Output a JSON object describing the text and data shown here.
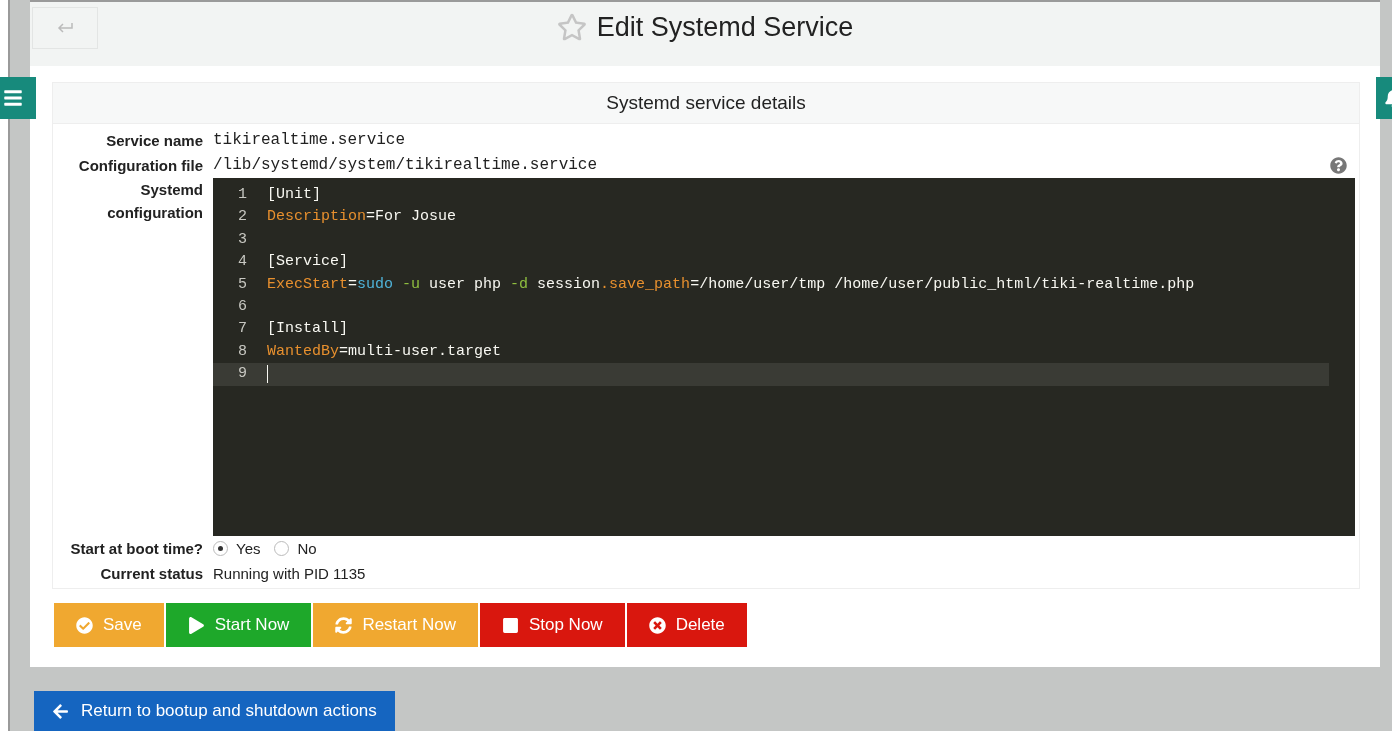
{
  "header": {
    "title": "Edit Systemd Service"
  },
  "panel": {
    "heading": "Systemd service details"
  },
  "fields": [
    {
      "label": "Service name",
      "value": "tikirealtime.service"
    },
    {
      "label": "Configuration file",
      "value": "/lib/systemd/system/tikirealtime.service"
    }
  ],
  "editor": {
    "label": "Systemd configuration",
    "lines": [
      {
        "number": "1",
        "active": false,
        "tokens": [
          {
            "kind": "plain",
            "text": "[Unit]"
          }
        ]
      },
      {
        "number": "2",
        "active": false,
        "tokens": [
          {
            "kind": "key",
            "text": "Description"
          },
          {
            "kind": "plain",
            "text": "=For Josue"
          }
        ]
      },
      {
        "number": "3",
        "active": false
      },
      {
        "number": "4",
        "active": false,
        "tokens": [
          {
            "kind": "plain",
            "text": "[Service]"
          }
        ]
      },
      {
        "number": "5",
        "active": false,
        "tokens": [
          {
            "kind": "key",
            "text": "ExecStart"
          },
          {
            "kind": "plain",
            "text": "="
          },
          {
            "kind": "command",
            "text": "sudo "
          },
          {
            "kind": "flag",
            "text": "-u"
          },
          {
            "kind": "plain",
            "text": " user php "
          },
          {
            "kind": "flag",
            "text": "-d"
          },
          {
            "kind": "plain",
            "text": " session"
          },
          {
            "kind": "key",
            "text": ".save_path"
          },
          {
            "kind": "plain",
            "text": "=/home/user/tmp /home/user/public_html/tiki-realtime.php"
          }
        ]
      },
      {
        "number": "6",
        "active": false
      },
      {
        "number": "7",
        "active": false,
        "tokens": [
          {
            "kind": "plain",
            "text": "[Install]"
          }
        ]
      },
      {
        "number": "8",
        "active": false,
        "tokens": [
          {
            "kind": "key",
            "text": "WantedBy"
          },
          {
            "kind": "plain",
            "text": "=multi-user.target"
          }
        ]
      },
      {
        "number": "9",
        "active": true
      }
    ]
  },
  "boot": {
    "label": "Start at boot time?",
    "options": [
      {
        "label": "Yes",
        "selected": true
      },
      {
        "label": "No",
        "selected": false
      }
    ]
  },
  "status": {
    "label": "Current status",
    "value": "Running with PID 1135"
  },
  "buttons": [
    {
      "kind": "save",
      "label": "Save"
    },
    {
      "kind": "start",
      "label": "Start Now"
    },
    {
      "kind": "restart",
      "label": "Restart Now"
    },
    {
      "kind": "stop",
      "label": "Stop Now"
    },
    {
      "kind": "delete",
      "label": "Delete"
    }
  ],
  "return_button": {
    "label": "Return to bootup and shutdown actions"
  }
}
